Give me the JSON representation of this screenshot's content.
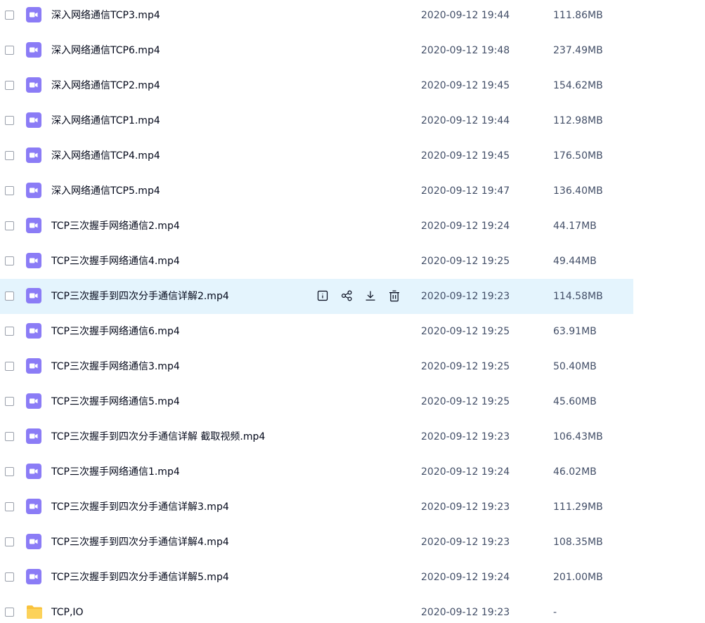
{
  "colors": {
    "video_icon": "#8b7cf6",
    "folder_icon": "#f9c23c",
    "hover_row": "#e4f4fd",
    "text_primary": "#03081a",
    "text_secondary": "#424e67"
  },
  "row_actions": [
    {
      "name": "details",
      "icon": "info-icon"
    },
    {
      "name": "share",
      "icon": "share-icon"
    },
    {
      "name": "download",
      "icon": "download-icon"
    },
    {
      "name": "delete",
      "icon": "trash-icon"
    }
  ],
  "files": [
    {
      "name": "深入网络通信TCP3.mp4",
      "date": "2020-09-12 19:44",
      "size": "111.86MB",
      "type": "video"
    },
    {
      "name": "深入网络通信TCP6.mp4",
      "date": "2020-09-12 19:48",
      "size": "237.49MB",
      "type": "video"
    },
    {
      "name": "深入网络通信TCP2.mp4",
      "date": "2020-09-12 19:45",
      "size": "154.62MB",
      "type": "video"
    },
    {
      "name": "深入网络通信TCP1.mp4",
      "date": "2020-09-12 19:44",
      "size": "112.98MB",
      "type": "video"
    },
    {
      "name": "深入网络通信TCP4.mp4",
      "date": "2020-09-12 19:45",
      "size": "176.50MB",
      "type": "video"
    },
    {
      "name": "深入网络通信TCP5.mp4",
      "date": "2020-09-12 19:47",
      "size": "136.40MB",
      "type": "video"
    },
    {
      "name": "TCP三次握手网络通信2.mp4",
      "date": "2020-09-12 19:24",
      "size": "44.17MB",
      "type": "video"
    },
    {
      "name": "TCP三次握手网络通信4.mp4",
      "date": "2020-09-12 19:25",
      "size": "49.44MB",
      "type": "video"
    },
    {
      "name": "TCP三次握手到四次分手通信详解2.mp4",
      "date": "2020-09-12 19:23",
      "size": "114.58MB",
      "type": "video",
      "hovered": true
    },
    {
      "name": "TCP三次握手网络通信6.mp4",
      "date": "2020-09-12 19:25",
      "size": "63.91MB",
      "type": "video"
    },
    {
      "name": "TCP三次握手网络通信3.mp4",
      "date": "2020-09-12 19:25",
      "size": "50.40MB",
      "type": "video"
    },
    {
      "name": "TCP三次握手网络通信5.mp4",
      "date": "2020-09-12 19:25",
      "size": "45.60MB",
      "type": "video"
    },
    {
      "name": "TCP三次握手到四次分手通信详解 截取视频.mp4",
      "date": "2020-09-12 19:23",
      "size": "106.43MB",
      "type": "video"
    },
    {
      "name": "TCP三次握手网络通信1.mp4",
      "date": "2020-09-12 19:24",
      "size": "46.02MB",
      "type": "video"
    },
    {
      "name": "TCP三次握手到四次分手通信详解3.mp4",
      "date": "2020-09-12 19:23",
      "size": "111.29MB",
      "type": "video"
    },
    {
      "name": "TCP三次握手到四次分手通信详解4.mp4",
      "date": "2020-09-12 19:23",
      "size": "108.35MB",
      "type": "video"
    },
    {
      "name": "TCP三次握手到四次分手通信详解5.mp4",
      "date": "2020-09-12 19:24",
      "size": "201.00MB",
      "type": "video"
    },
    {
      "name": "TCP,IO",
      "date": "2020-09-12 19:23",
      "size": "-",
      "type": "folder"
    }
  ]
}
